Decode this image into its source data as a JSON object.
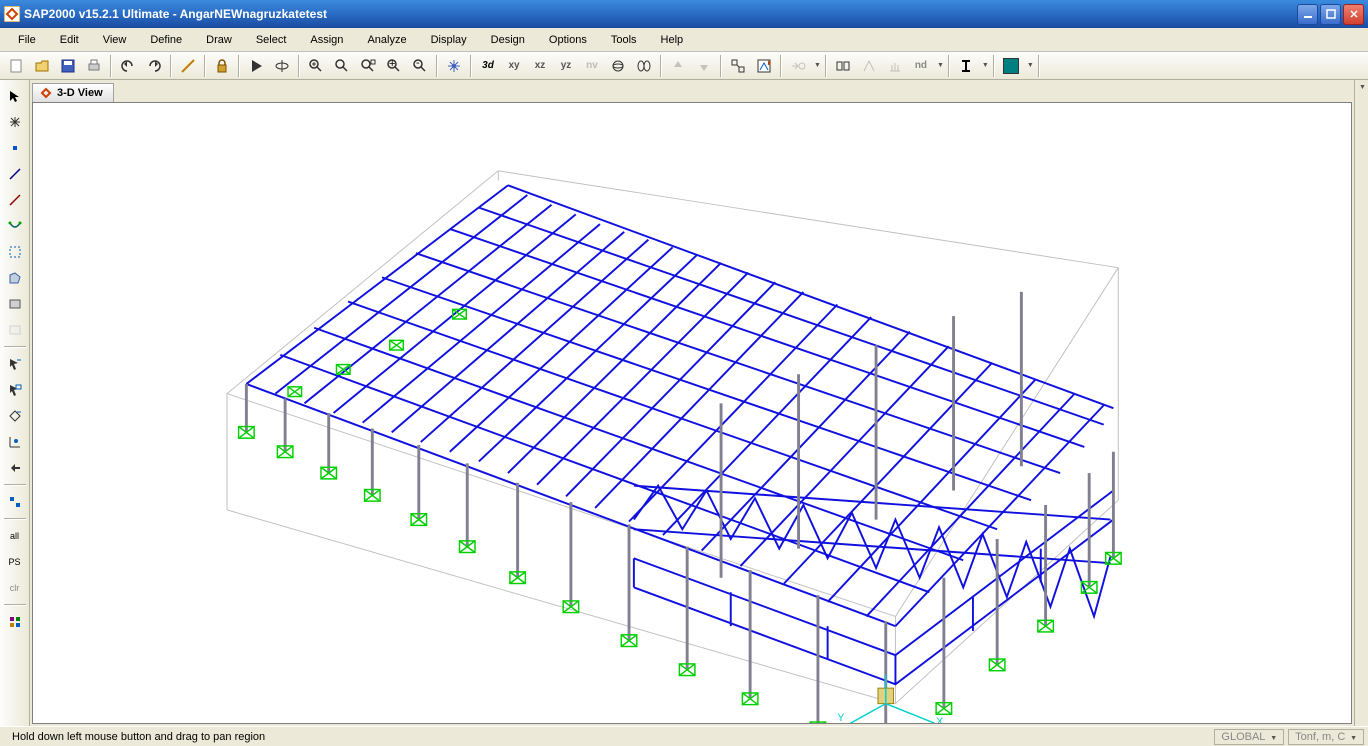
{
  "title": "SAP2000 v15.2.1 Ultimate  - AngarNEWnagruzkatetest",
  "menu": [
    "File",
    "Edit",
    "View",
    "Define",
    "Draw",
    "Select",
    "Assign",
    "Analyze",
    "Display",
    "Design",
    "Options",
    "Tools",
    "Help"
  ],
  "tab": {
    "label": "3-D View"
  },
  "plane_labels": {
    "xy": "xy",
    "xz": "xz",
    "yz": "yz",
    "nv": "nv",
    "nd": "nd"
  },
  "status": {
    "hint": "Hold down left mouse button and drag to pan region",
    "coord": "GLOBAL",
    "units": "Tonf, m, C"
  },
  "side_labels": {
    "all": "all",
    "ps": "PS",
    "clr": "clr"
  }
}
